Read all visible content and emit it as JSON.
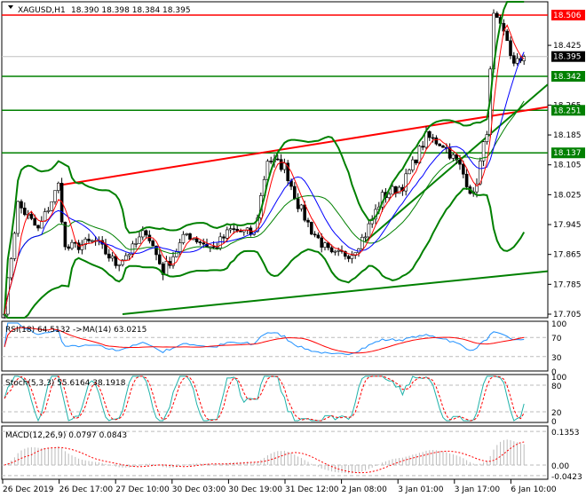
{
  "chart_data": {
    "type": "candlestick",
    "symbol": "XAGUSD,H1",
    "ohlc_header": {
      "open": "18.390",
      "high": "18.398",
      "low": "18.384",
      "close": "18.395"
    },
    "price_axis": {
      "ylim": [
        17.705,
        18.506
      ],
      "ticks": [
        "18.425",
        "18.265",
        "18.185",
        "18.105",
        "18.025",
        "17.945",
        "17.865",
        "17.785",
        "17.705"
      ]
    },
    "levels": [
      {
        "value": 18.506,
        "label": "18.506",
        "color": "#ff0000"
      },
      {
        "value": 18.395,
        "label": "18.395",
        "color": "#000000",
        "line": "#c0c0c0"
      },
      {
        "value": 18.342,
        "label": "18.342",
        "color": "#008000"
      },
      {
        "value": 18.251,
        "label": "18.251",
        "color": "#008000"
      },
      {
        "value": 18.137,
        "label": "18.137",
        "color": "#008000"
      }
    ],
    "candle_count": 155,
    "approx_close_path": [
      [
        0,
        17.72
      ],
      [
        4,
        18.0
      ],
      [
        10,
        17.93
      ],
      [
        16,
        18.05
      ],
      [
        18,
        17.88
      ],
      [
        27,
        17.9
      ],
      [
        33,
        17.84
      ],
      [
        38,
        17.88
      ],
      [
        42,
        17.93
      ],
      [
        47,
        17.82
      ],
      [
        54,
        17.92
      ],
      [
        62,
        17.88
      ],
      [
        67,
        17.93
      ],
      [
        74,
        17.92
      ],
      [
        78,
        18.12
      ],
      [
        83,
        18.1
      ],
      [
        87,
        18.0
      ],
      [
        91,
        17.93
      ],
      [
        97,
        17.86
      ],
      [
        103,
        17.87
      ],
      [
        107,
        17.92
      ],
      [
        112,
        18.02
      ],
      [
        118,
        18.05
      ],
      [
        125,
        18.18
      ],
      [
        130,
        18.16
      ],
      [
        135,
        18.1
      ],
      [
        139,
        18.02
      ],
      [
        143,
        18.2
      ],
      [
        145,
        18.5
      ],
      [
        149,
        18.44
      ],
      [
        151,
        18.37
      ],
      [
        154,
        18.395
      ]
    ],
    "trendlines": [
      {
        "color": "#ff0000",
        "from": [
          16,
          18.05
        ],
        "to": [
          161,
          18.26
        ]
      },
      {
        "color": "#008000",
        "from": [
          35,
          17.705
        ],
        "to": [
          161,
          17.82
        ]
      },
      {
        "color": "#008000",
        "from": [
          107,
          17.9
        ],
        "to": [
          161,
          18.32
        ]
      }
    ],
    "rsi": {
      "label": "RSI(18) 64.5132  ->MA(14) 63.0215",
      "levels": [
        "100",
        "70",
        "30",
        "0"
      ]
    },
    "stoch": {
      "label": "Stoch(5,3,3) 55.6164 38.1918",
      "levels": [
        "100",
        "80",
        "20",
        "0"
      ]
    },
    "macd": {
      "label": "MACD(12,26,9) 0.0797 0.0843",
      "levels": [
        "0.1353",
        "0.00",
        "-0.0423"
      ]
    },
    "time_labels": [
      "26 Dec 2019",
      "26 Dec 17:00",
      "27 Dec 10:00",
      "30 Dec 03:00",
      "30 Dec 19:00",
      "31 Dec 12:00",
      "2 Jan 08:00",
      "3 Jan 01:00",
      "3 Jan 17:00",
      "6 Jan 10:00"
    ]
  }
}
